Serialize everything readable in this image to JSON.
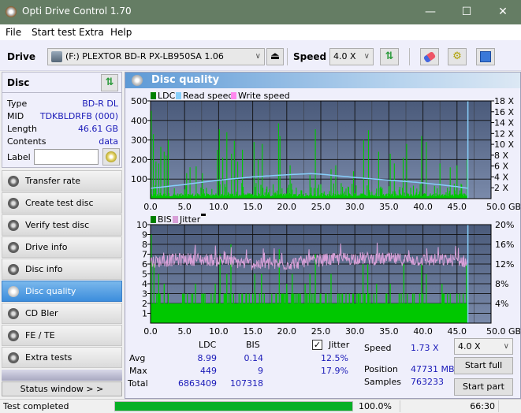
{
  "window": {
    "title": "Opti Drive Control 1.70",
    "minimize_glyph": "—",
    "maximize_glyph": "☐",
    "close_glyph": "✕"
  },
  "menu": [
    "File",
    "Start test",
    "Extra",
    "Help"
  ],
  "toolbar": {
    "drive_label": "Drive",
    "drive_value": "(F:)  PLEXTOR BD-R  PX-LB950SA 1.06",
    "speed_label": "Speed",
    "speed_value": "4.0 X",
    "icons": [
      "eject-icon",
      "refresh-icon",
      "eraser-icon",
      "settings-icon",
      "save-icon"
    ]
  },
  "disc": {
    "header": "Disc",
    "fields": [
      {
        "key": "Type",
        "value": "BD-R DL"
      },
      {
        "key": "MID",
        "value": "TDKBLDRFB (000)"
      },
      {
        "key": "Length",
        "value": "46.61 GB"
      },
      {
        "key": "Contents",
        "value": "data"
      }
    ],
    "label_key": "Label",
    "label_value": ""
  },
  "nav": [
    {
      "label": "Transfer rate",
      "active": false
    },
    {
      "label": "Create test disc",
      "active": false
    },
    {
      "label": "Verify test disc",
      "active": false
    },
    {
      "label": "Drive info",
      "active": false
    },
    {
      "label": "Disc info",
      "active": false
    },
    {
      "label": "Disc quality",
      "active": true
    },
    {
      "label": "CD Bler",
      "active": false
    },
    {
      "label": "FE / TE",
      "active": false
    },
    {
      "label": "Extra tests",
      "active": false
    }
  ],
  "status_window_label": "Status window > >",
  "panel_title": "Disc quality",
  "colors": {
    "ldc": "#00c800",
    "ldc_legend": "#008000",
    "read_speed": "#87cefa",
    "write_speed": "#ff88ee",
    "jitter": "#d8a0d8",
    "plot_bg_top": "#4a5a7a",
    "plot_bg_bottom": "#7a8aaa",
    "progress": "#06b025",
    "accent_blue": "#1a1ab8"
  },
  "chart_data": [
    {
      "type": "bar",
      "title": "LDC / Read speed",
      "legend": [
        "LDC",
        "Read speed",
        "Write speed"
      ],
      "legend_placement": "top-left",
      "xlabel": "GB",
      "x_ticks": [
        "0.0",
        "5.0",
        "10.0",
        "15.0",
        "20.0",
        "25.0",
        "30.0",
        "35.0",
        "40.0",
        "45.0",
        "50.0 GB"
      ],
      "xlim": [
        0,
        50
      ],
      "y_ticks_left": [
        "100",
        "200",
        "300",
        "400",
        "500"
      ],
      "ylim_left": [
        0,
        500
      ],
      "y_ticks_right": [
        "2 X",
        "4 X",
        "6 X",
        "8 X",
        "10 X",
        "12 X",
        "14 X",
        "16 X",
        "18 X"
      ],
      "ylim_right": [
        0,
        18
      ],
      "grid": true,
      "ldc_peaks": [
        [
          0.1,
          449
        ],
        [
          0.4,
          330
        ],
        [
          0.8,
          190
        ],
        [
          1.2,
          180
        ],
        [
          1.5,
          265
        ],
        [
          2.0,
          240
        ],
        [
          2.3,
          220
        ],
        [
          2.6,
          300
        ],
        [
          5.3,
          130
        ],
        [
          5.8,
          160
        ],
        [
          6.7,
          165
        ],
        [
          7.6,
          130
        ],
        [
          9.8,
          250
        ],
        [
          10.1,
          355
        ],
        [
          10.6,
          210
        ],
        [
          11.2,
          340
        ],
        [
          11.9,
          230
        ],
        [
          12.3,
          295
        ],
        [
          12.8,
          190
        ],
        [
          13.5,
          250
        ],
        [
          15.2,
          290
        ],
        [
          15.8,
          200
        ],
        [
          16.4,
          280
        ],
        [
          18.8,
          385
        ],
        [
          19.0,
          320
        ],
        [
          20.5,
          170
        ],
        [
          23.4,
          120
        ],
        [
          24.2,
          355
        ],
        [
          26.5,
          150
        ],
        [
          27.2,
          170
        ],
        [
          29.8,
          140
        ],
        [
          31.3,
          300
        ],
        [
          32.0,
          350
        ],
        [
          33.5,
          240
        ],
        [
          35.2,
          230
        ],
        [
          35.8,
          180
        ],
        [
          37.1,
          210
        ],
        [
          37.6,
          280
        ],
        [
          39.8,
          320
        ],
        [
          40.5,
          290
        ],
        [
          42.5,
          180
        ],
        [
          44.0,
          160
        ],
        [
          45.0,
          170
        ],
        [
          46.5,
          200
        ]
      ],
      "read_speed_x": [
        0,
        5,
        10,
        15,
        20,
        23.5,
        25,
        30,
        35,
        40,
        45,
        46.6
      ],
      "read_speed_values": [
        1.9,
        2.6,
        3.4,
        4.0,
        4.4,
        4.6,
        4.5,
        3.9,
        3.4,
        2.9,
        2.2,
        1.9
      ],
      "end_marker_gb": 46.6
    },
    {
      "type": "bar",
      "title": "BIS / Jitter",
      "legend": [
        "BIS",
        "Jitter"
      ],
      "legend_placement": "top-left",
      "xlabel": "GB",
      "x_ticks": [
        "0.0",
        "5.0",
        "10.0",
        "15.0",
        "20.0",
        "25.0",
        "30.0",
        "35.0",
        "40.0",
        "45.0",
        "50.0 GB"
      ],
      "xlim": [
        0,
        50
      ],
      "y_ticks_left": [
        "1",
        "2",
        "3",
        "4",
        "5",
        "6",
        "7",
        "8",
        "9",
        "10"
      ],
      "ylim_left": [
        0,
        10
      ],
      "y_ticks_right": [
        "4%",
        "8%",
        "12%",
        "16%",
        "20%"
      ],
      "ylim_right": [
        0,
        20
      ],
      "grid": true,
      "bis_baseline": 2,
      "bis_peaks": [
        [
          0.1,
          9
        ],
        [
          0.5,
          6
        ],
        [
          1.2,
          5
        ],
        [
          2.0,
          4
        ],
        [
          5.0,
          3
        ],
        [
          6.6,
          4
        ],
        [
          7.8,
          3
        ],
        [
          9.5,
          4
        ],
        [
          10.2,
          7
        ],
        [
          11.2,
          5
        ],
        [
          11.8,
          8
        ],
        [
          13.4,
          3
        ],
        [
          15.3,
          5
        ],
        [
          16.3,
          5
        ],
        [
          18.9,
          7.5
        ],
        [
          20.0,
          4
        ],
        [
          20.8,
          5
        ],
        [
          22.7,
          4
        ],
        [
          23.4,
          5
        ],
        [
          24.2,
          7
        ],
        [
          26.5,
          5
        ],
        [
          28.0,
          3
        ],
        [
          31.2,
          6
        ],
        [
          31.9,
          6
        ],
        [
          33.2,
          4
        ],
        [
          35.2,
          4
        ],
        [
          36.5,
          3
        ],
        [
          37.2,
          6
        ],
        [
          39.8,
          6
        ],
        [
          40.5,
          5
        ],
        [
          42.8,
          4
        ],
        [
          44.0,
          3
        ],
        [
          46.4,
          6
        ]
      ],
      "jitter_x": [
        0,
        5,
        10,
        15,
        20,
        25,
        30,
        35,
        40,
        45,
        46.6
      ],
      "jitter_values_pct": [
        12.5,
        13.0,
        12.8,
        12.0,
        12.0,
        12.8,
        13.2,
        13.0,
        12.8,
        12.8,
        12.4
      ],
      "end_marker_gb": 46.6
    }
  ],
  "stats": {
    "col_ldc": "LDC",
    "col_bis": "BIS",
    "rows": [
      {
        "label": "Avg",
        "ldc": "8.99",
        "bis": "0.14",
        "jitter": "12.5%"
      },
      {
        "label": "Max",
        "ldc": "449",
        "bis": "9",
        "jitter": "17.9%"
      },
      {
        "label": "Total",
        "ldc": "6863409",
        "bis": "107318",
        "jitter": ""
      }
    ],
    "jitter_label": "Jitter",
    "jitter_checked": true,
    "speed_label": "Speed",
    "speed_value": "1.73 X",
    "position_label": "Position",
    "position_value": "47731 MB",
    "samples_label": "Samples",
    "samples_value": "763233",
    "speed_select": "4.0 X",
    "start_full": "Start full",
    "start_part": "Start part"
  },
  "statusbar": {
    "text": "Test completed",
    "progress_pct": 100,
    "progress_label": "100.0%",
    "time": "66:30"
  }
}
